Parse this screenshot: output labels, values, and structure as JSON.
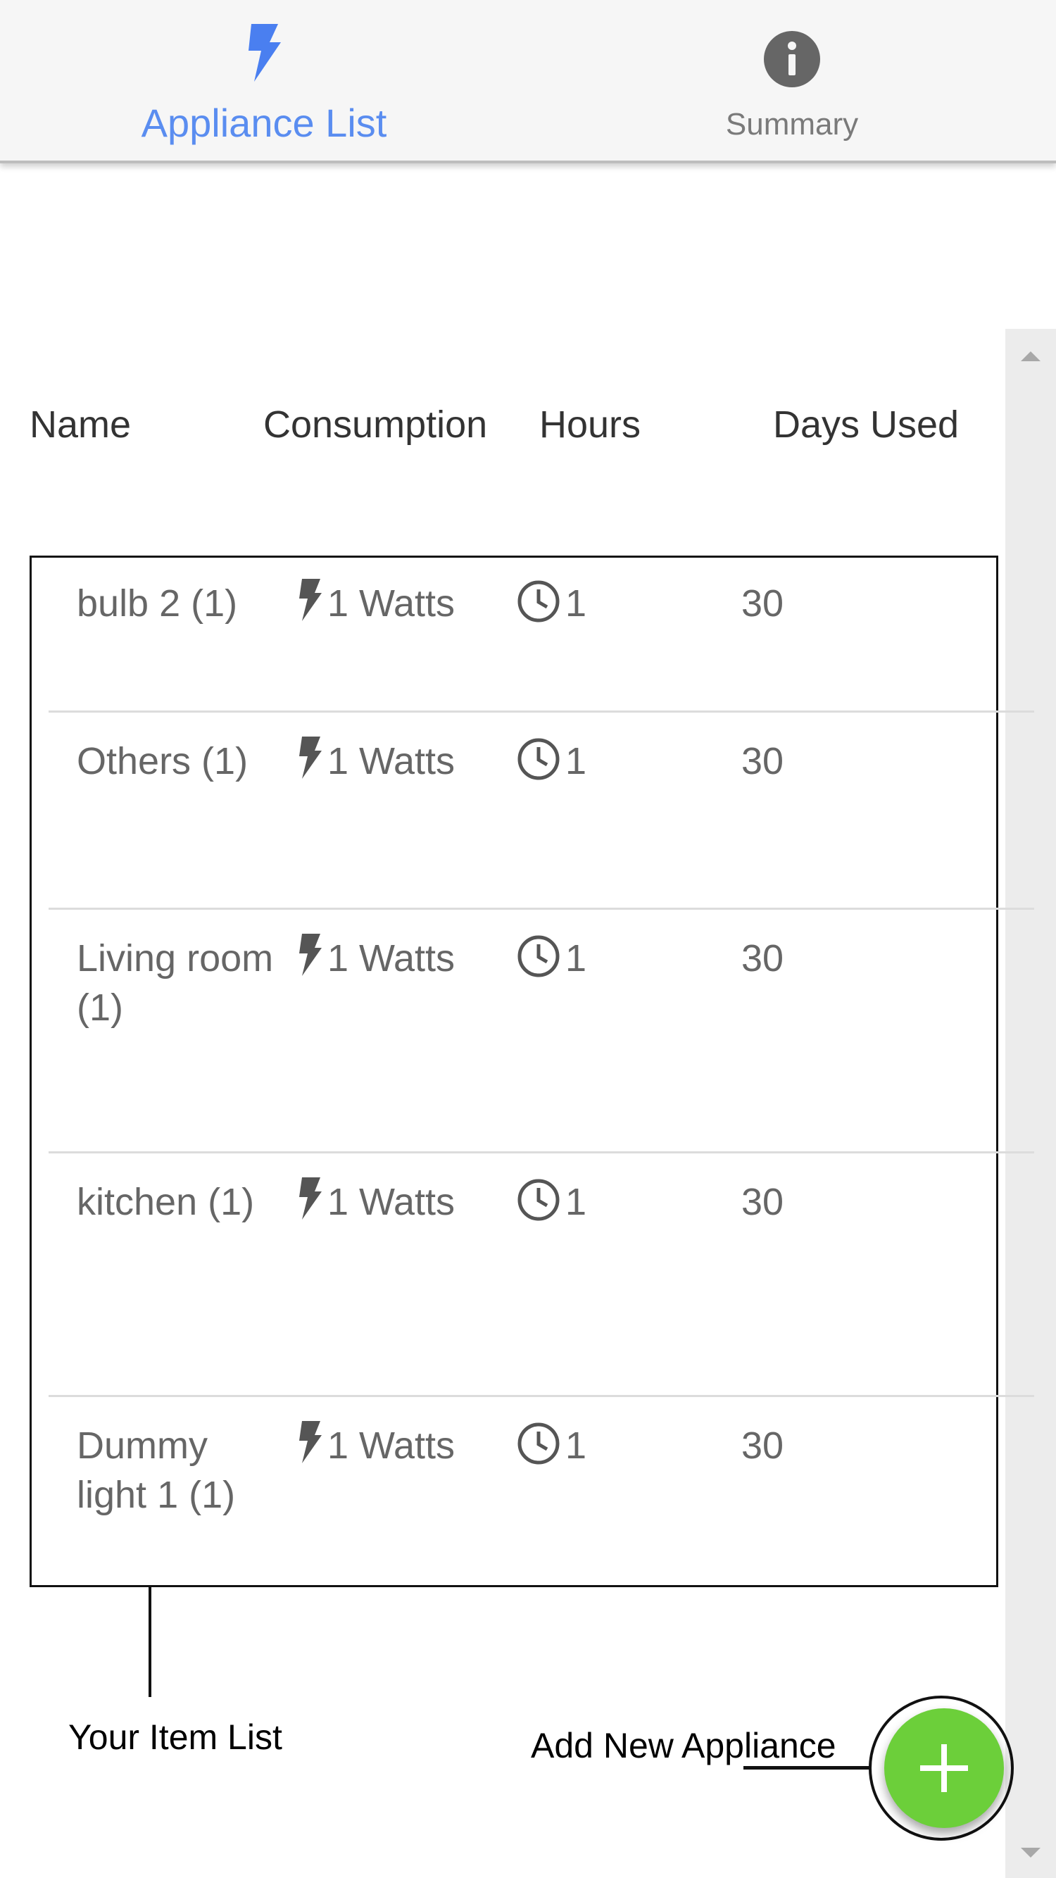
{
  "tabs": [
    {
      "label": "Appliance List",
      "icon": "lightning-bolt-icon",
      "active": true,
      "color": "#5a8df0"
    },
    {
      "label": "Summary",
      "icon": "info-icon",
      "active": false,
      "color": "#7a7a7a"
    }
  ],
  "table": {
    "columns": [
      "Name",
      "Consumption",
      "Hours",
      "Days Used"
    ],
    "rows": [
      {
        "name": "bulb 2 (1)",
        "consumption": "1 Watts",
        "hours": "1",
        "days": "30"
      },
      {
        "name": "Others (1)",
        "consumption": "1 Watts",
        "hours": "1",
        "days": "30"
      },
      {
        "name": "Living room (1)",
        "consumption": "1 Watts",
        "hours": "1",
        "days": "30"
      },
      {
        "name": "kitchen (1)",
        "consumption": "1 Watts",
        "hours": "1",
        "days": "30"
      },
      {
        "name": "Dummy light 1 (1)",
        "consumption": "1 Watts",
        "hours": "1",
        "days": "30"
      }
    ]
  },
  "annotations": {
    "item_list": "Your Item List",
    "add_appliance": "Add New Appliance"
  },
  "fab": {
    "icon": "plus-icon",
    "color": "#6ccf3a"
  }
}
